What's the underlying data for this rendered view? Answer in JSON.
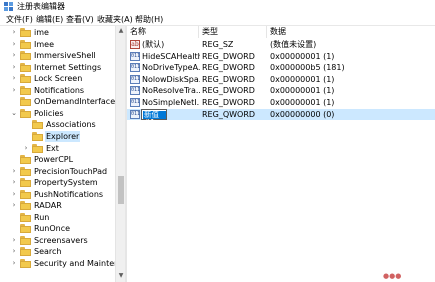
{
  "window": {
    "title": "注册表编辑器",
    "icon": "registry-editor-icon"
  },
  "menu": [
    {
      "label": "文件(F)"
    },
    {
      "label": "编辑(E)"
    },
    {
      "label": "查看(V)"
    },
    {
      "label": "收藏夹(A)"
    },
    {
      "label": "帮助(H)"
    }
  ],
  "tree": {
    "items": [
      {
        "label": "ime",
        "expander": "›",
        "selected": false
      },
      {
        "label": "Imee",
        "expander": "›",
        "selected": false
      },
      {
        "label": "ImmersiveShell",
        "expander": "›",
        "selected": false
      },
      {
        "label": "Internet Settings",
        "expander": "›",
        "selected": false
      },
      {
        "label": "Lock Screen",
        "expander": "›",
        "selected": false
      },
      {
        "label": "Notifications",
        "expander": "›",
        "selected": false
      },
      {
        "label": "OnDemandInterfaceC",
        "expander": "",
        "selected": false
      },
      {
        "label": "Policies",
        "expander": "⌄",
        "selected": false
      },
      {
        "label": "Associations",
        "expander": "",
        "selected": false
      },
      {
        "label": "Explorer",
        "expander": "",
        "selected": true
      },
      {
        "label": "Ext",
        "expander": "›",
        "selected": false
      },
      {
        "label": "PowerCPL",
        "expander": "",
        "selected": false
      },
      {
        "label": "PrecisionTouchPad",
        "expander": "›",
        "selected": false
      },
      {
        "label": "PropertySystem",
        "expander": "›",
        "selected": false
      },
      {
        "label": "PushNotifications",
        "expander": "›",
        "selected": false
      },
      {
        "label": "RADAR",
        "expander": "›",
        "selected": false
      },
      {
        "label": "Run",
        "expander": "",
        "selected": false
      },
      {
        "label": "RunOnce",
        "expander": "",
        "selected": false
      },
      {
        "label": "Screensavers",
        "expander": "›",
        "selected": false
      },
      {
        "label": "Search",
        "expander": "›",
        "selected": false
      },
      {
        "label": "Security and Mainten",
        "expander": "›",
        "selected": false
      }
    ]
  },
  "list": {
    "headers": {
      "name": "名称",
      "type": "类型",
      "data": "数据"
    },
    "rows": [
      {
        "icon": "ab",
        "icon_kind": "string-value-icon",
        "name": "(默认)",
        "type": "REG_SZ",
        "data": "(数值未设置)"
      },
      {
        "icon": "011",
        "icon_kind": "binary-value-icon",
        "name": "HideSCAHealth",
        "type": "REG_DWORD",
        "data": "0x00000001 (1)"
      },
      {
        "icon": "011",
        "icon_kind": "binary-value-icon",
        "name": "NoDriveTypeA...",
        "type": "REG_DWORD",
        "data": "0x000000b5 (181)"
      },
      {
        "icon": "011",
        "icon_kind": "binary-value-icon",
        "name": "NolowDiskSpa...",
        "type": "REG_DWORD",
        "data": "0x00000001 (1)"
      },
      {
        "icon": "011",
        "icon_kind": "binary-value-icon",
        "name": "NoResolveTra...",
        "type": "REG_DWORD",
        "data": "0x00000001 (1)"
      },
      {
        "icon": "011",
        "icon_kind": "binary-value-icon",
        "name": "NoSimpleNetI...",
        "type": "REG_DWORD",
        "data": "0x00000001 (1)"
      }
    ],
    "editing_row": {
      "icon": "011",
      "icon_kind": "binary-value-icon",
      "name_value": "新值 #1",
      "type": "REG_QWORD",
      "data": "0x00000000 (0)"
    }
  },
  "colors": {
    "selection": "#cce8ff",
    "text_selection": "#0078d7",
    "folder": "#f2c94c"
  }
}
